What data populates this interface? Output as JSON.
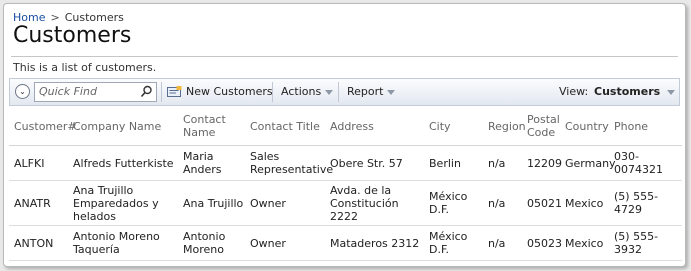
{
  "breadcrumb": {
    "home": "Home",
    "separator": ">",
    "current": "Customers"
  },
  "page": {
    "title": "Customers",
    "description": "This is a list of customers."
  },
  "toolbar": {
    "quick_find_placeholder": "Quick Find",
    "new_label": "New Customers",
    "actions_label": "Actions",
    "report_label": "Report",
    "view_label": "View:",
    "view_value": "Customers"
  },
  "grid": {
    "headers": [
      "Customer#",
      "Company Name",
      "Contact Name",
      "Contact Title",
      "Address",
      "City",
      "Region",
      "Postal Code",
      "Country",
      "Phone"
    ],
    "rows": [
      [
        "ALFKI",
        "Alfreds Futterkiste",
        "Maria Anders",
        "Sales Representative",
        "Obere Str. 57",
        "Berlin",
        "n/a",
        "12209",
        "Germany",
        "030-0074321"
      ],
      [
        "ANATR",
        "Ana Trujillo Emparedados y helados",
        "Ana Trujillo",
        "Owner",
        "Avda. de la Constitución 2222",
        "México D.F.",
        "n/a",
        "05021",
        "Mexico",
        "(5) 555-4729"
      ],
      [
        "ANTON",
        "Antonio Moreno Taquería",
        "Antonio Moreno",
        "Owner",
        "Mataderos 2312",
        "México D.F.",
        "n/a",
        "05023",
        "Mexico",
        "(5) 555-3932"
      ]
    ]
  }
}
